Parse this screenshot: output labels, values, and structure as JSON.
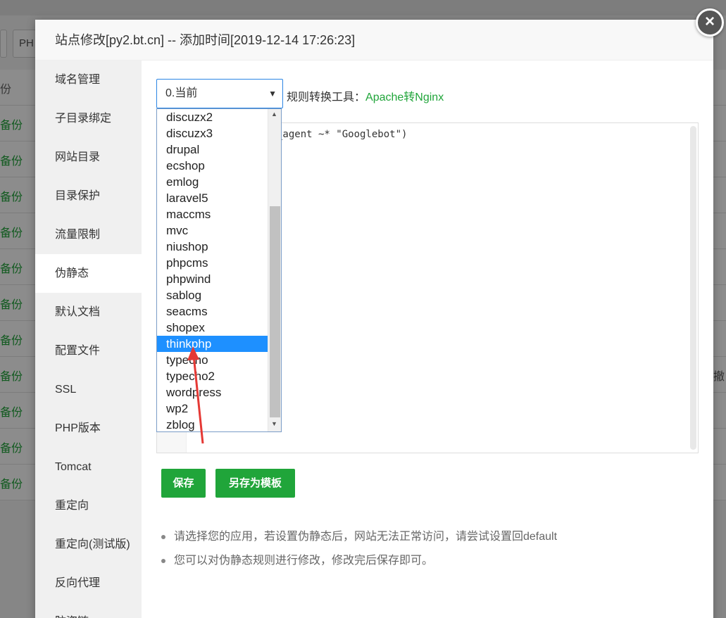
{
  "background": {
    "button_php": "PH",
    "rows": [
      {
        "label": "份",
        "color": "gray"
      },
      {
        "label": "备份"
      },
      {
        "label": "备份"
      },
      {
        "label": "备份"
      },
      {
        "label": "备份"
      },
      {
        "label": "备份"
      },
      {
        "label": "备份"
      },
      {
        "label": "备份"
      },
      {
        "label": "备份"
      },
      {
        "label": "备份"
      },
      {
        "label": "备份"
      },
      {
        "label": "备份"
      }
    ],
    "right_text": "撤"
  },
  "dialog": {
    "title": "站点修改[py2.bt.cn] -- 添加时间[2019-12-14 17:26:23]",
    "close_label": "×"
  },
  "sidebar": {
    "items": [
      {
        "label": "域名管理"
      },
      {
        "label": "子目录绑定"
      },
      {
        "label": "网站目录"
      },
      {
        "label": "目录保护"
      },
      {
        "label": "流量限制"
      },
      {
        "label": "伪静态",
        "active": true
      },
      {
        "label": "默认文档"
      },
      {
        "label": "配置文件"
      },
      {
        "label": "SSL"
      },
      {
        "label": "PHP版本"
      },
      {
        "label": "Tomcat"
      },
      {
        "label": "重定向"
      },
      {
        "label": "重定向(测试版)"
      },
      {
        "label": "反向代理"
      },
      {
        "label": "防盗链"
      }
    ]
  },
  "rewrite": {
    "select_value": "0.当前",
    "select_arrow": "▼",
    "tool_label": "规则转换工具：",
    "tool_link": "Apache转Nginx",
    "editor_text": "_agent ~* \"Googlebot\")",
    "options": [
      "discuzx2",
      "discuzx3",
      "drupal",
      "ecshop",
      "emlog",
      "laravel5",
      "maccms",
      "mvc",
      "niushop",
      "phpcms",
      "phpwind",
      "sablog",
      "seacms",
      "shopex",
      "thinkphp",
      "typecho",
      "typecho2",
      "wordpress",
      "wp2",
      "zblog"
    ],
    "selected_option": "thinkphp",
    "save_label": "保存",
    "save_template_label": "另存为模板",
    "tips": [
      "请选择您的应用，若设置伪静态后，网站无法正常访问，请尝试设置回default",
      "您可以对伪静态规则进行修改，修改完后保存即可。"
    ]
  },
  "colors": {
    "accent_green": "#20a53a",
    "select_blue": "#1e90ff",
    "annotation_red": "#e53935"
  }
}
